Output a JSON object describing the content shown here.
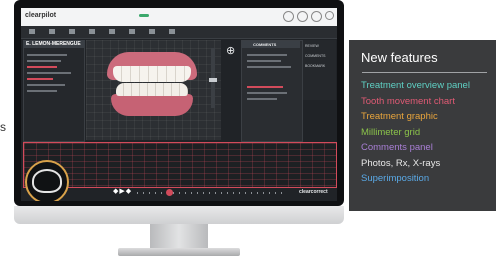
{
  "app": {
    "logo": "clearpilot",
    "patient_name": "E. LEMON-MERENGUE",
    "bottom_brand": "clearcorrect",
    "comments_title": "COMMENTS",
    "right_menu": [
      "REVIEW",
      "COMMENTS",
      "BOOKMARK"
    ],
    "split_icon": "⊕",
    "play_controls": "◆▶◆"
  },
  "features": {
    "title": "New features",
    "items": [
      {
        "label": "Treatment overview panel",
        "color": "#5fd0c4"
      },
      {
        "label": "Tooth movement chart",
        "color": "#e05a74"
      },
      {
        "label": "Treatment graphic",
        "color": "#e9a53c"
      },
      {
        "label": "Millimeter grid",
        "color": "#8bc34a"
      },
      {
        "label": "Comments panel",
        "color": "#a97fd6"
      },
      {
        "label": "Photos, Rx, X-rays",
        "color": "#e8e8e8"
      },
      {
        "label": "Superimposition",
        "color": "#5aa9e6"
      }
    ]
  },
  "edge_text": "s"
}
